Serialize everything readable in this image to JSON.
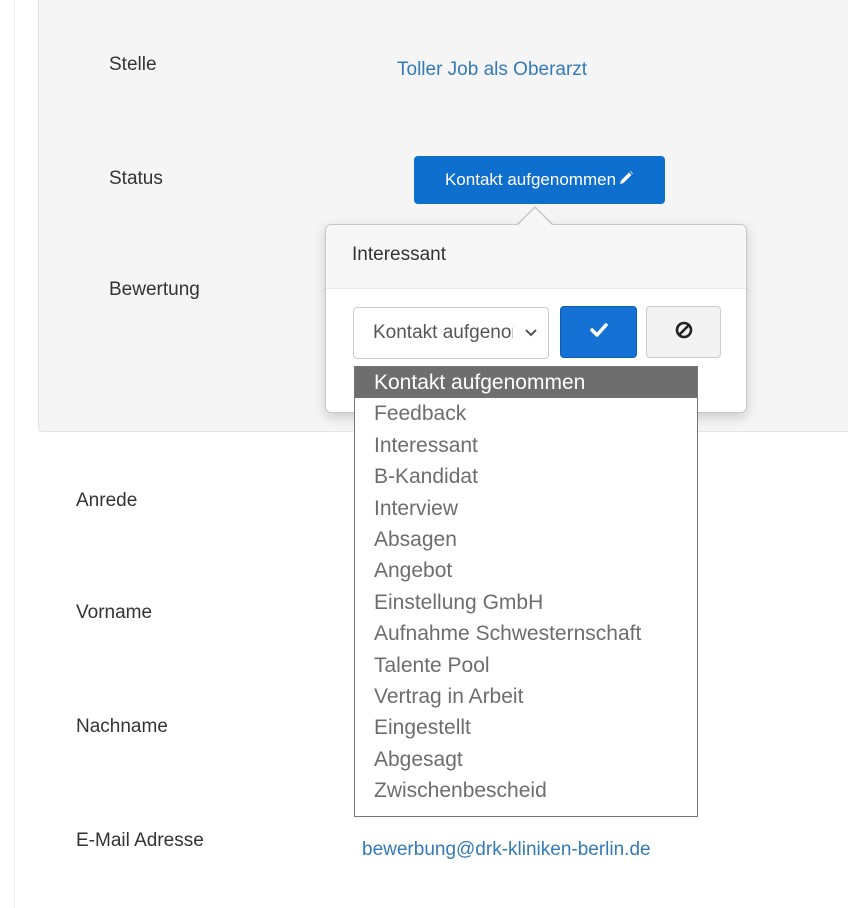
{
  "details": {
    "stelle_label": "Stelle",
    "stelle_value": "Toller Job als Oberarzt",
    "status_label": "Status",
    "status_value": "Kontakt aufgenommen",
    "bewertung_label": "Bewertung",
    "anrede_label": "Anrede",
    "vorname_label": "Vorname",
    "nachname_label": "Nachname",
    "email_label": "E-Mail Adresse",
    "email_value": "bewerbung@drk-kliniken-berlin.de"
  },
  "popover": {
    "title": "Interessant",
    "select_value": "Kontakt aufgenommen",
    "confirm_icon": "check-icon",
    "cancel_icon": "ban-icon"
  },
  "dropdown": {
    "selected": "Kontakt aufgenommen",
    "options": [
      "Kontakt aufgenommen",
      "Feedback",
      "Interessant",
      "B-Kandidat",
      "Interview",
      "Absagen",
      "Angebot",
      "Einstellung GmbH",
      "Aufnahme Schwesternschaft",
      "Talente Pool",
      "Vertrag in Arbeit",
      "Eingestellt",
      "Abgesagt",
      "Zwischenbescheid"
    ]
  },
  "colors": {
    "link": "#337ab7",
    "primary_button": "#0f6fcf",
    "panel_bg": "#f5f5f5",
    "selected_option_bg": "#6e6e6e"
  }
}
